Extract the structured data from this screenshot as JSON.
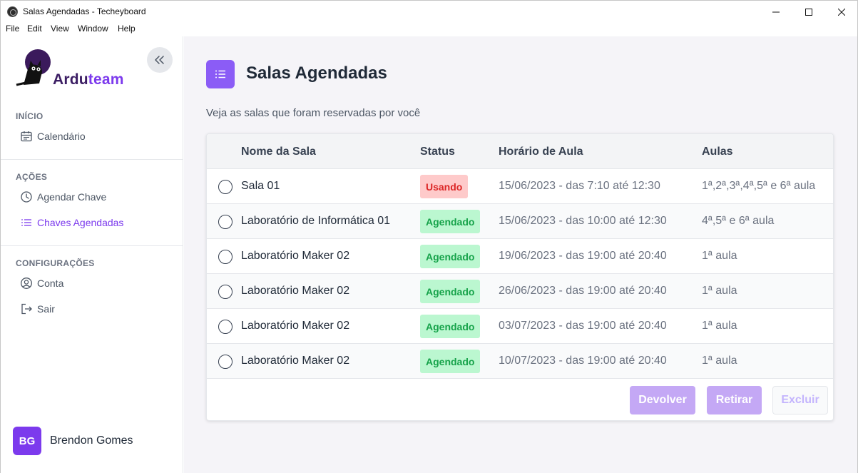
{
  "window": {
    "title": "Salas Agendadas - Techeyboard",
    "menu": [
      "File",
      "Edit",
      "View",
      "Window",
      "Help"
    ]
  },
  "sidebar": {
    "brand_dark": "Ardu",
    "brand_accent": "team",
    "sections": [
      {
        "label": "INÍCIO",
        "items": [
          {
            "label": "Calendário",
            "icon": "calendar-icon",
            "active": false
          }
        ]
      },
      {
        "label": "AÇÕES",
        "items": [
          {
            "label": "Agendar Chave",
            "icon": "clock-icon",
            "active": false
          },
          {
            "label": "Chaves Agendadas",
            "icon": "list-icon",
            "active": true
          }
        ]
      },
      {
        "label": "CONFIGURAÇÕES",
        "items": [
          {
            "label": "Conta",
            "icon": "user-circle-icon",
            "active": false
          },
          {
            "label": "Sair",
            "icon": "logout-icon",
            "active": false
          }
        ]
      }
    ],
    "user": {
      "initials": "BG",
      "name": "Brendon Gomes"
    }
  },
  "main": {
    "title": "Salas Agendadas",
    "subtitle": "Veja as salas que foram reservadas por você",
    "table": {
      "headers": [
        "Nome da Sala",
        "Status",
        "Horário de Aula",
        "Aulas"
      ],
      "rows": [
        {
          "name": "Sala 01",
          "status": "Usando",
          "time": "15/06/2023 - das 7:10 até 12:30",
          "aulas": "1ª,2ª,3ª,4ª,5ª e 6ª aula"
        },
        {
          "name": "Laboratório de Informática 01",
          "status": "Agendado",
          "time": "15/06/2023 - das 10:00 até 12:30",
          "aulas": "4ª,5ª e 6ª aula"
        },
        {
          "name": "Laboratório Maker 02",
          "status": "Agendado",
          "time": "19/06/2023 - das 19:00 até 20:40",
          "aulas": "1ª aula"
        },
        {
          "name": "Laboratório Maker 02",
          "status": "Agendado",
          "time": "26/06/2023 - das 19:00 até 20:40",
          "aulas": "1ª aula"
        },
        {
          "name": "Laboratório Maker 02",
          "status": "Agendado",
          "time": "03/07/2023 - das 19:00 até 20:40",
          "aulas": "1ª aula"
        },
        {
          "name": "Laboratório Maker 02",
          "status": "Agendado",
          "time": "10/07/2023 - das 19:00 até 20:40",
          "aulas": "1ª aula"
        }
      ]
    },
    "actions": {
      "devolver": "Devolver",
      "retirar": "Retirar",
      "excluir": "Excluir"
    }
  },
  "colors": {
    "accent": "#7c3aed",
    "usando_bg": "#fecaca",
    "usando_text": "#dc2626",
    "agendado_bg": "#bbf7d0",
    "agendado_text": "#16a34a"
  }
}
